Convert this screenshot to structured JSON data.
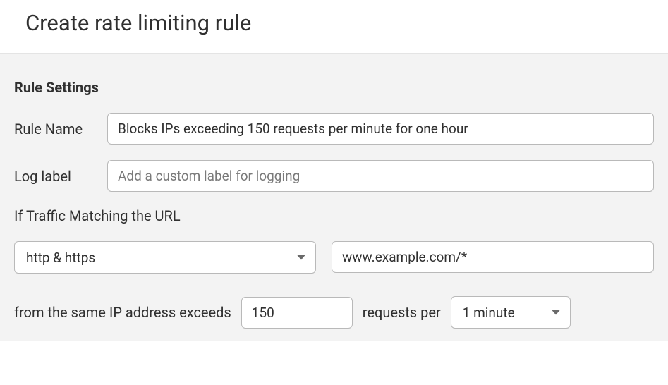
{
  "header": {
    "title": "Create rate limiting rule"
  },
  "section": {
    "title": "Rule Settings"
  },
  "ruleName": {
    "label": "Rule Name",
    "value": "Blocks IPs exceeding 150 requests per minute for one hour"
  },
  "logLabel": {
    "label": "Log label",
    "placeholder": "Add a custom label for logging",
    "value": ""
  },
  "traffic": {
    "heading": "If Traffic Matching the URL",
    "scheme": "http & https",
    "urlPattern": "www.example.com/*"
  },
  "threshold": {
    "prefix": "from the same IP address exceeds",
    "count": "150",
    "mid": "requests per",
    "period": "1 minute"
  }
}
